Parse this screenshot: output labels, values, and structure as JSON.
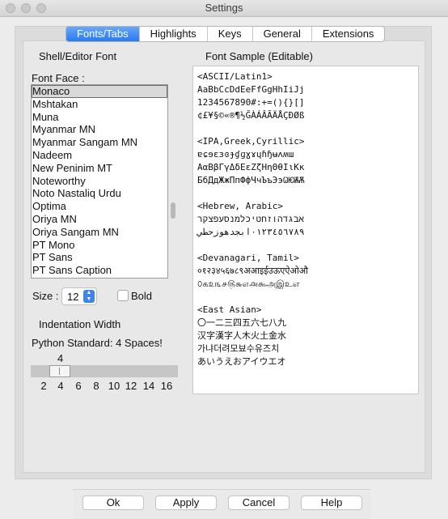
{
  "window": {
    "title": "Settings"
  },
  "tabs": [
    "Fonts/Tabs",
    "Highlights",
    "Keys",
    "General",
    "Extensions"
  ],
  "font_section": {
    "heading": "Shell/Editor Font",
    "face_label": "Font Face :",
    "fonts": [
      "Monaco",
      "Mshtakan",
      "Muna",
      "Myanmar MN",
      "Myanmar Sangam MN",
      "Nadeem",
      "New Peninim MT",
      "Noteworthy",
      "Noto Nastaliq Urdu",
      "Optima",
      "Oriya MN",
      "Oriya Sangam MN",
      "PT Mono",
      "PT Sans",
      "PT Sans Caption"
    ],
    "selected_font": "Monaco",
    "size_label": "Size :",
    "size_value": "12",
    "bold_label": "Bold",
    "bold_checked": false
  },
  "indent_section": {
    "heading": "Indentation Width",
    "note": "Python Standard: 4 Spaces!",
    "value": "4",
    "ticks": [
      "2",
      "4",
      "6",
      "8",
      "10",
      "12",
      "14",
      "16"
    ]
  },
  "sample": {
    "heading": "Font Sample (Editable)",
    "lines": [
      "<ASCII/Latin1>",
      "AaBbCcDdEeFfGgHhIiJj",
      "1234567890#:+=(){}[]",
      "¢£¥§©«®¶½ĞÀÁÂÃÄÅÇÐØß",
      "",
      "<IPA,Greek,Cyrillic>",
      "ɐɕɘɛɜɞɟɠɡɣɤɥɦɧʉʌʍɯ",
      "ΑαΒβΓγΔδΕεΖζΗηΘθΙιΚκ",
      "БбДдЖжПпФфЧчЪъЭэѠѤѬѪ",
      "",
      "<Hebrew, Arabic>",
      "אבגדהוזחטיכלמנסעפצקר",
      "٠١٢٣٤٥٦٧٨٩ابجدهوزحطي",
      "",
      "<Devanagari, Tamil>",
      "०१२३४५६७८९अआइईउऊएऐओऔ",
      "௦௧௨௩௪௫௬௭௮௯அஇஉஎ",
      "",
      "<East Asian>",
      "〇一二三四五六七八九",
      "汉字漢字人木火土金水",
      "가냐더려모뵤수유즈치",
      "あいうえおアイウエオ"
    ]
  },
  "buttons": {
    "ok": "Ok",
    "apply": "Apply",
    "cancel": "Cancel",
    "help": "Help"
  },
  "colors": {
    "accent": "#2a79ef",
    "selection": "#d9d9d9",
    "window_bg": "#ececec"
  }
}
